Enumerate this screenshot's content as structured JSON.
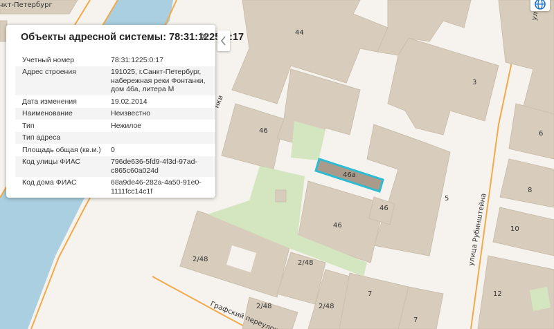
{
  "panel": {
    "title": "Объекты адресной системы: 78:31:1225:0:17",
    "rows": [
      {
        "key": "Учетный номер",
        "value": [
          "78:31:1225:0:17"
        ]
      },
      {
        "key": "Адрес строения",
        "value": [
          "191025, г.Санкт-Петербург,",
          "набережная реки Фонтанки,",
          "дом 46а, литера М"
        ]
      },
      {
        "key": "Дата изменения",
        "value": [
          "19.02.2014"
        ]
      },
      {
        "key": "Наименование",
        "value": [
          "Неизвестно"
        ]
      },
      {
        "key": "Тип",
        "value": [
          "Нежилое"
        ]
      },
      {
        "key": "Тип адреса",
        "value": [
          ""
        ]
      },
      {
        "key": "Площадь общая (кв.м.)",
        "value": [
          "0"
        ]
      },
      {
        "key": "Код улицы ФИАС",
        "value": [
          "796de636-5fd9-4f3d-97ad-",
          "c865c60a024d"
        ]
      },
      {
        "key": "Код дома ФИАС",
        "value": [
          "68a9de46-282a-4a50-91e0-",
          "1111fcc14c1f"
        ]
      }
    ]
  },
  "map": {
    "labels": {
      "city_fragment": "нкт-Петербург",
      "street_rubinshteyna": "улица Рубинштейна",
      "street_grafsky": "Графский переулок",
      "street_fontanka_fragment": "нки",
      "street_right_fragment": "ул",
      "b44": "44",
      "b3": "3",
      "b46_a": "46",
      "b46a": "46а",
      "b46_b": "46",
      "b46_c": "46",
      "b5": "5",
      "b6": "6",
      "b8": "8",
      "b10": "10",
      "b12": "12",
      "b7": "7",
      "b7_b": "7",
      "b248_a": "2/48",
      "b248_b": "2/48",
      "b248_c": "2/48",
      "b248_d": "2/48"
    },
    "colors": {
      "building": "#d8cdbc",
      "building_stroke": "#cbbfae",
      "water": "#a9cfe0",
      "park": "#d4e6bf",
      "road_orange": "#f2a94a",
      "selected_fill": "#a99a8a",
      "selected_stroke": "#2bbcd4"
    }
  },
  "icons": {
    "close": "close-icon",
    "collapse": "chevron-left-icon",
    "globe": "globe-icon"
  }
}
